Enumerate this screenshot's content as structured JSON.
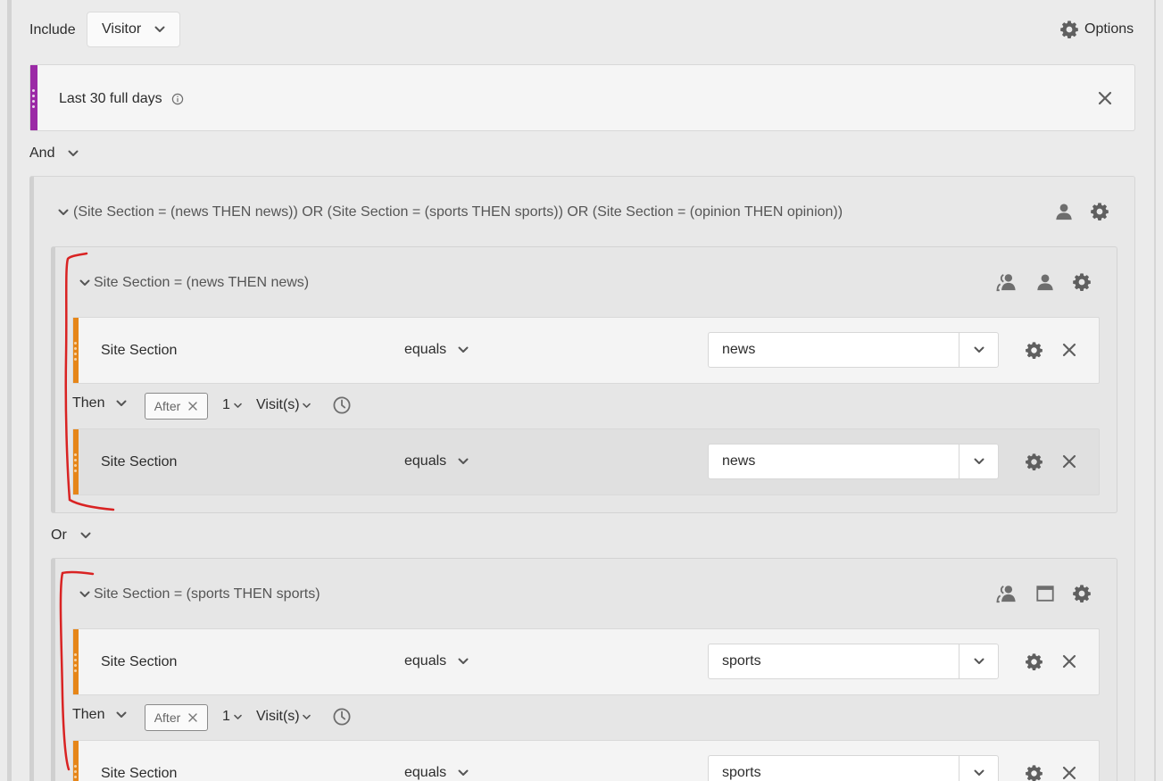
{
  "header": {
    "include_label": "Include",
    "container_value": "Visitor",
    "options_label": "Options"
  },
  "date_range": {
    "label": "Last 30 full days"
  },
  "logic": {
    "and_label": "And",
    "or_label": "Or"
  },
  "outer_group": {
    "title": "(Site Section = (news THEN news)) OR (Site Section = (sports THEN sports)) OR (Site Section = (opinion THEN opinion))"
  },
  "groups": [
    {
      "title": "Site Section = (news THEN news)",
      "rules": [
        {
          "dimension": "Site Section",
          "operator": "equals",
          "value": "news"
        },
        {
          "dimension": "Site Section",
          "operator": "equals",
          "value": "news"
        }
      ],
      "then": {
        "label": "Then",
        "after": "After",
        "count": "1",
        "unit": "Visit(s)"
      }
    },
    {
      "title": "Site Section = (sports THEN sports)",
      "rules": [
        {
          "dimension": "Site Section",
          "operator": "equals",
          "value": "sports"
        },
        {
          "dimension": "Site Section",
          "operator": "equals",
          "value": "sports"
        }
      ],
      "then": {
        "label": "Then",
        "after": "After",
        "count": "1",
        "unit": "Visit(s)"
      }
    }
  ],
  "colors": {
    "date_stripe": "#9b2aa6",
    "rule_stripe": "#e68619",
    "annotation": "#d92323",
    "icon": "#6e6e6e"
  },
  "icons": [
    "chevron-down-icon",
    "gear-icon",
    "close-icon",
    "info-icon",
    "person-icon",
    "people-icon",
    "window-icon",
    "clock-icon"
  ]
}
